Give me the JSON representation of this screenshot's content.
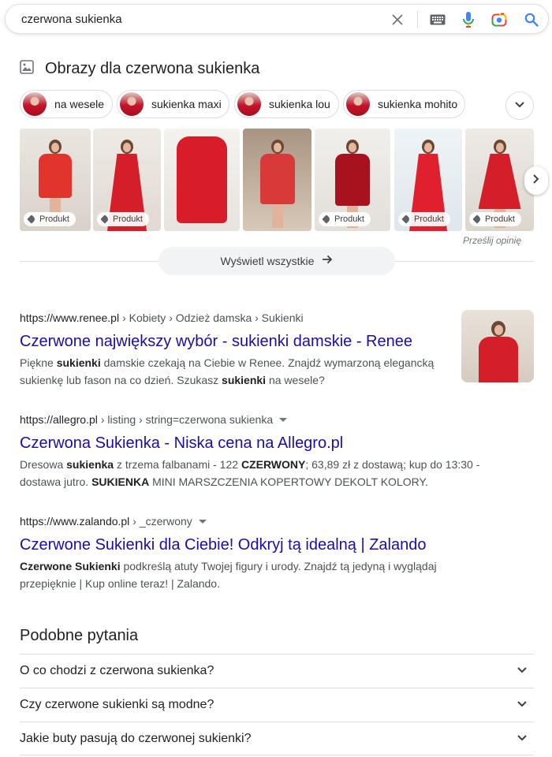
{
  "search": {
    "query": "czerwona sukienka"
  },
  "images": {
    "title": "Obrazy dla czerwona sukienka",
    "chips": [
      "na wesele",
      "sukienka maxi",
      "sukienka lou",
      "sukienka mohito"
    ],
    "badge_label": "Produkt",
    "feedback": "Prześlij opinię",
    "view_all": "Wyświetl wszystkie"
  },
  "results": [
    {
      "url": "https://www.renee.pl",
      "path": "› Kobiety › Odzież damska › Sukienki",
      "title": "Czerwone największy wybór - sukienki damskie - Renee",
      "snippet_parts": [
        [
          "Piękne ",
          false
        ],
        [
          "sukienki",
          true
        ],
        [
          " damskie czekają na Ciebie w Renee. Znajdź wymarzoną elegancką sukienkę lub fason na co dzień. Szukasz ",
          false
        ],
        [
          "sukienki",
          true
        ],
        [
          " na wesele?",
          false
        ]
      ]
    },
    {
      "url": "https://allegro.pl",
      "path": "› listing › string=czerwona sukienka",
      "title": "Czerwona Sukienka - Niska cena na Allegro.pl",
      "snippet_parts": [
        [
          "Dresowa ",
          false
        ],
        [
          "sukienka",
          true
        ],
        [
          " z trzema falbanami - 122 ",
          false
        ],
        [
          "CZERWONY",
          true
        ],
        [
          "; 63,89 zł z dostawą; kup do 13:30 - dostawa jutro. ",
          false
        ],
        [
          "SUKIENKA",
          true
        ],
        [
          " MINI MARSZCZENIA KOPERTOWY DEKOLT KOLORY.",
          false
        ]
      ]
    },
    {
      "url": "https://www.zalando.pl",
      "path": "› _czerwony",
      "title": "Czerwone Sukienki dla Ciebie! Odkryj tą idealną | Zalando",
      "snippet_parts": [
        [
          "Czerwone Sukienki",
          true
        ],
        [
          " podkreślą atuty Twojej figury i urody. Znajdź tą jedyną i wyglądaj przepięknie | Kup online teraz! | Zalando.",
          false
        ]
      ]
    }
  ],
  "paa": {
    "title": "Podobne pytania",
    "questions": [
      "O co chodzi z czerwona sukienka?",
      "Czy czerwone sukienki są modne?",
      "Jakie buty pasują do czerwonej sukienki?"
    ]
  },
  "colors": {
    "link": "#1a0dab",
    "dress_red": "#d41f2b"
  },
  "icons": {
    "clear": "close-icon",
    "keyboard": "keyboard-icon",
    "mic": "microphone-icon",
    "lens": "google-lens-icon",
    "search": "search-icon",
    "images": "image-icon",
    "tag": "tag-icon",
    "chevron": "chevron-down-icon",
    "next": "chevron-right-icon"
  }
}
